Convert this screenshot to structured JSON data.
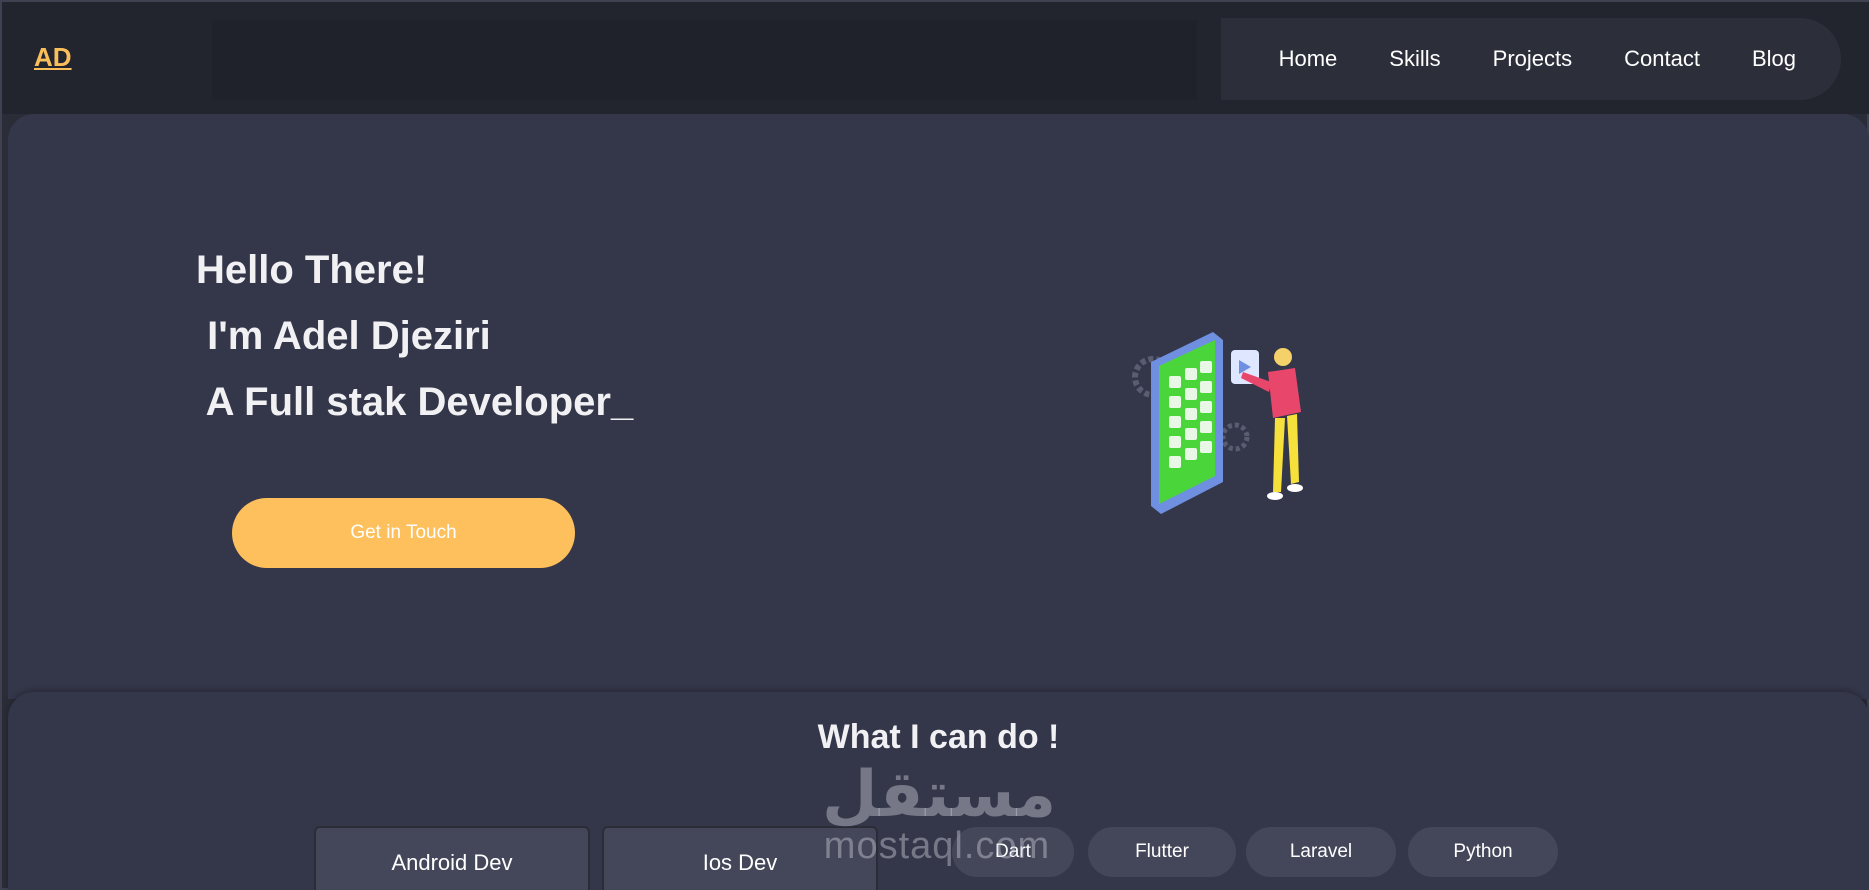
{
  "colors": {
    "accent": "#fec05c",
    "background": "#2a2c37",
    "surface": "#34374a",
    "chip": "#444759"
  },
  "navbar": {
    "logo": "AD",
    "links": [
      "Home",
      "Skills",
      "Projects",
      "Contact",
      "Blog"
    ]
  },
  "hero": {
    "line1": "Hello There!",
    "line2": " I'm Adel Djeziri",
    "line3": " A Full stak Developer_",
    "cta_label": "Get in Touch",
    "illustration_icon": "developer-with-phone-illustration"
  },
  "skills": {
    "title": "What I can do !",
    "tabs": [
      "Android Dev",
      "Ios Dev"
    ],
    "chips": [
      "Dart",
      "Flutter",
      "Laravel",
      "Python"
    ]
  },
  "watermark": {
    "arabic": "مستقل",
    "latin": "mostaql.com"
  }
}
